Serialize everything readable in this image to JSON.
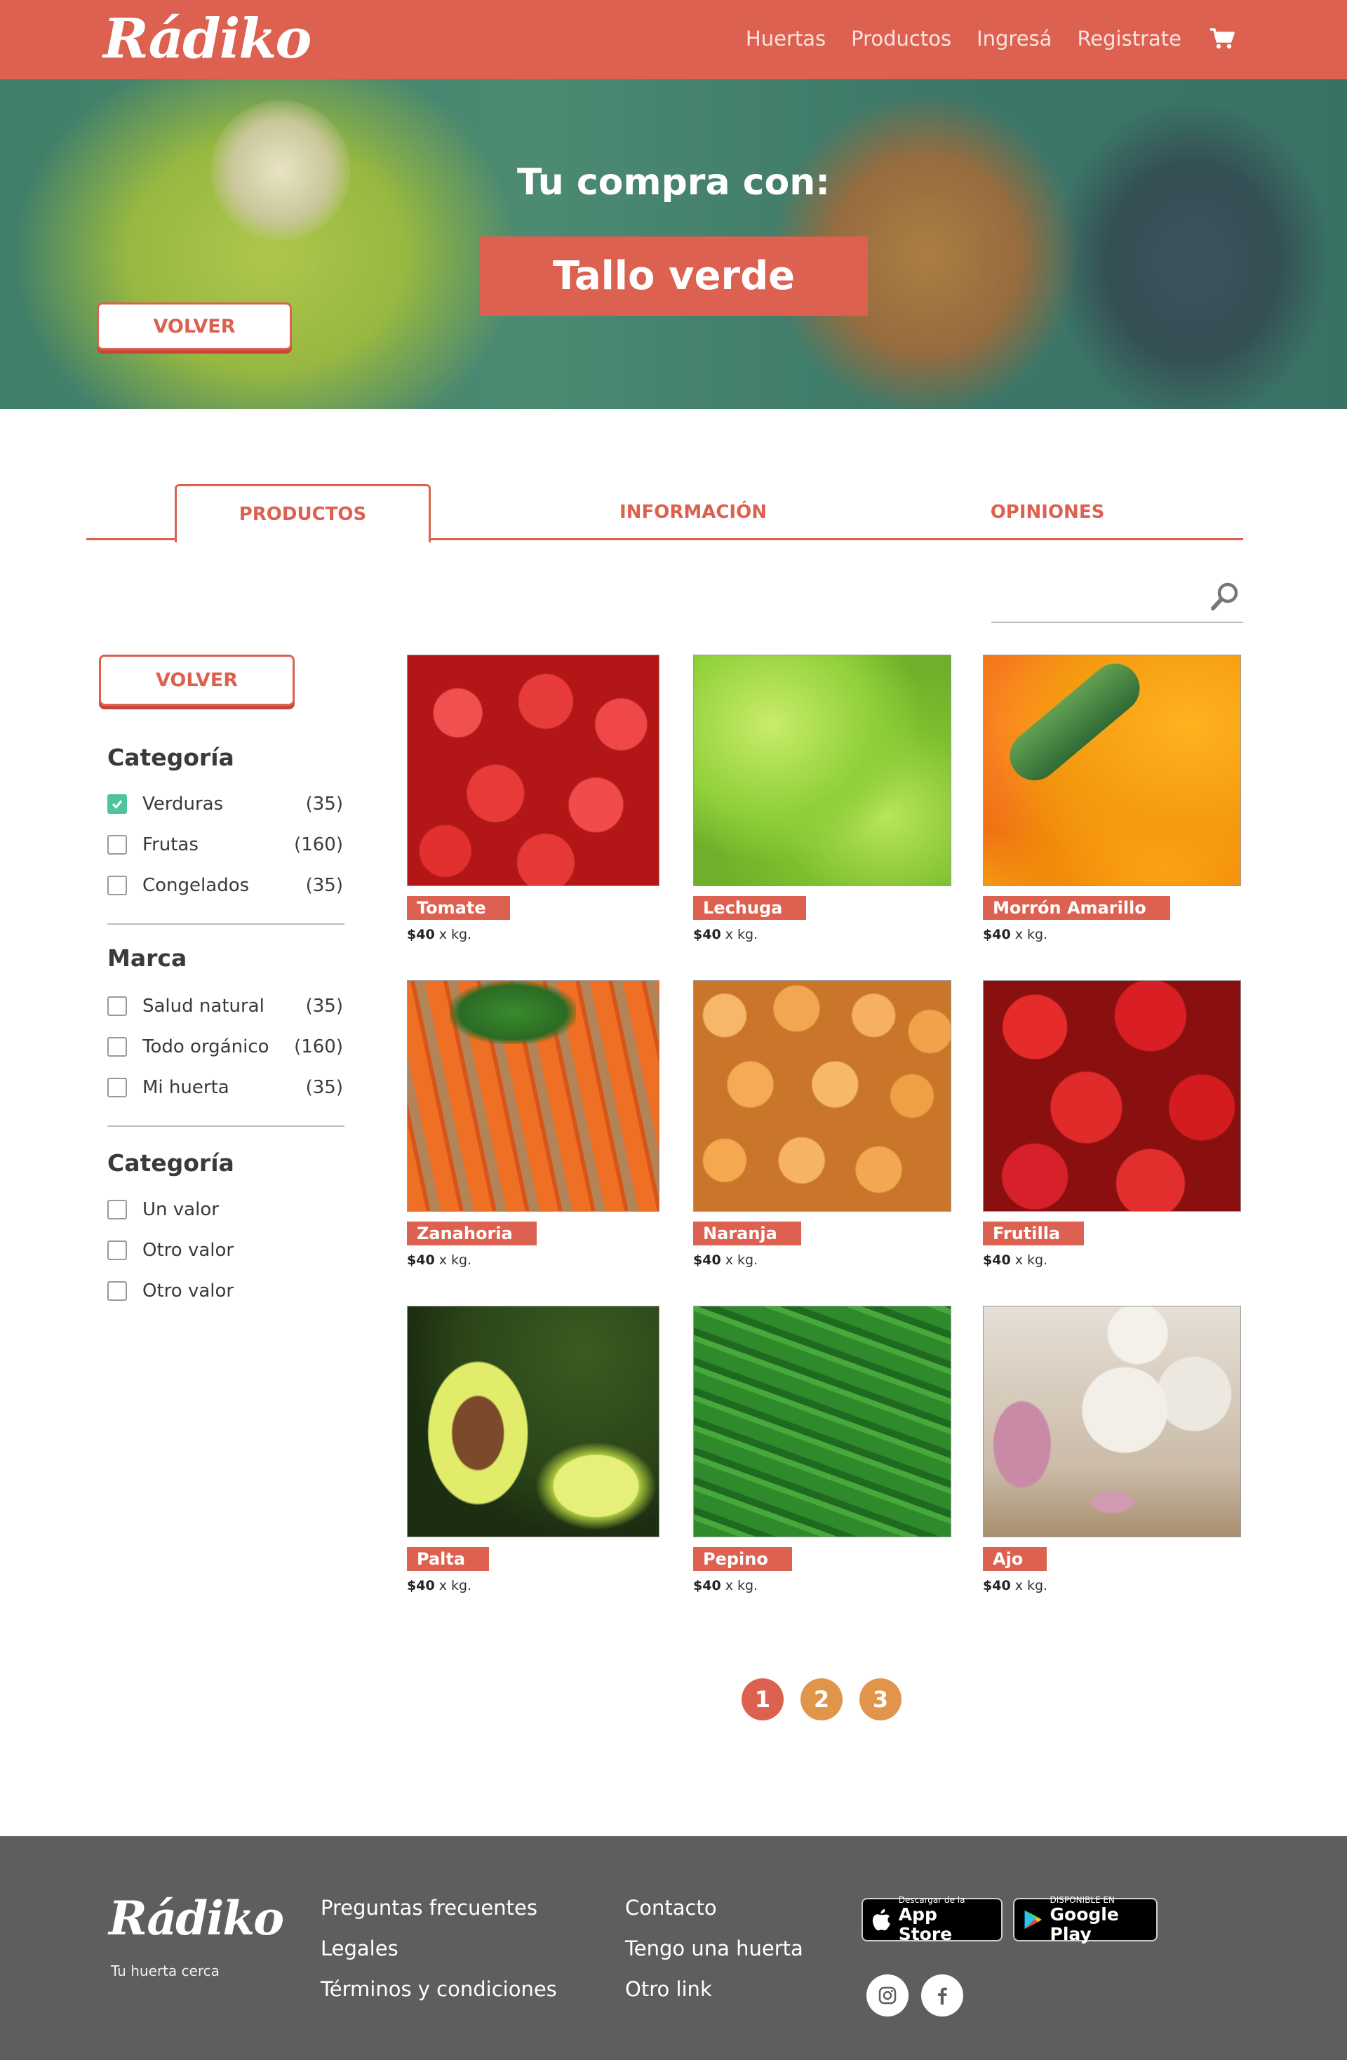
{
  "app": {
    "logo": "Rádiko"
  },
  "nav": {
    "items": [
      "Huertas",
      "Productos",
      "Ingresá",
      "Registrate"
    ],
    "cart_icon": "cart-icon"
  },
  "hero": {
    "title": "Tu compra con:",
    "store_name": "Tallo verde",
    "back_label": "VOLVER"
  },
  "tabs": [
    {
      "label": "PRODUCTOS",
      "active": true
    },
    {
      "label": "INFORMACIÓN",
      "active": false
    },
    {
      "label": "OPINIONES",
      "active": false
    }
  ],
  "search": {
    "placeholder": "",
    "icon": "search-icon"
  },
  "sidebar": {
    "back_label": "VOLVER",
    "groups": [
      {
        "title": "Categoría",
        "items": [
          {
            "label": "Verduras",
            "count": "(35)",
            "checked": true
          },
          {
            "label": "Frutas",
            "count": "(160)",
            "checked": false
          },
          {
            "label": "Congelados",
            "count": "(35)",
            "checked": false
          }
        ]
      },
      {
        "title": "Marca",
        "items": [
          {
            "label": "Salud natural",
            "count": "(35)",
            "checked": false
          },
          {
            "label": "Todo orgánico",
            "count": "(160)",
            "checked": false
          },
          {
            "label": "Mi huerta",
            "count": "(35)",
            "checked": false
          }
        ]
      },
      {
        "title": "Categoría",
        "items": [
          {
            "label": "Un valor",
            "count": "",
            "checked": false
          },
          {
            "label": "Otro valor",
            "count": "",
            "checked": false
          },
          {
            "label": "Otro valor",
            "count": "",
            "checked": false
          }
        ]
      }
    ]
  },
  "products": [
    {
      "name": "Tomate",
      "price": "$40",
      "unit": " x kg."
    },
    {
      "name": "Lechuga",
      "price": "$40",
      "unit": " x kg."
    },
    {
      "name": "Morrón Amarillo",
      "price": "$40",
      "unit": " x kg."
    },
    {
      "name": "Zanahoria",
      "price": "$40",
      "unit": " x kg."
    },
    {
      "name": "Naranja",
      "price": "$40",
      "unit": " x kg."
    },
    {
      "name": "Frutilla",
      "price": "$40",
      "unit": " x kg."
    },
    {
      "name": "Palta",
      "price": "$40",
      "unit": " x kg."
    },
    {
      "name": "Pepino",
      "price": "$40",
      "unit": " x kg."
    },
    {
      "name": "Ajo",
      "price": "$40",
      "unit": " x kg."
    }
  ],
  "pagination": {
    "pages": [
      "1",
      "2",
      "3"
    ],
    "current": "1"
  },
  "colors": {
    "brand": "#dc6150",
    "page_inactive": "#e0954a",
    "check": "#4fc49a",
    "footer": "#5e5e5e"
  },
  "footer": {
    "logo": "Rádiko",
    "tagline": "Tu huerta cerca",
    "links_col1": [
      "Preguntas frecuentes",
      "Legales",
      "Términos y condiciones"
    ],
    "links_col2": [
      "Contacto",
      "Tengo una huerta",
      "Otro link"
    ],
    "app_store": {
      "small": "Descargar de la",
      "big": "App Store"
    },
    "google_play": {
      "small": "DISPONIBLE EN",
      "big": "Google Play"
    },
    "social": [
      "instagram-icon",
      "facebook-icon"
    ]
  }
}
